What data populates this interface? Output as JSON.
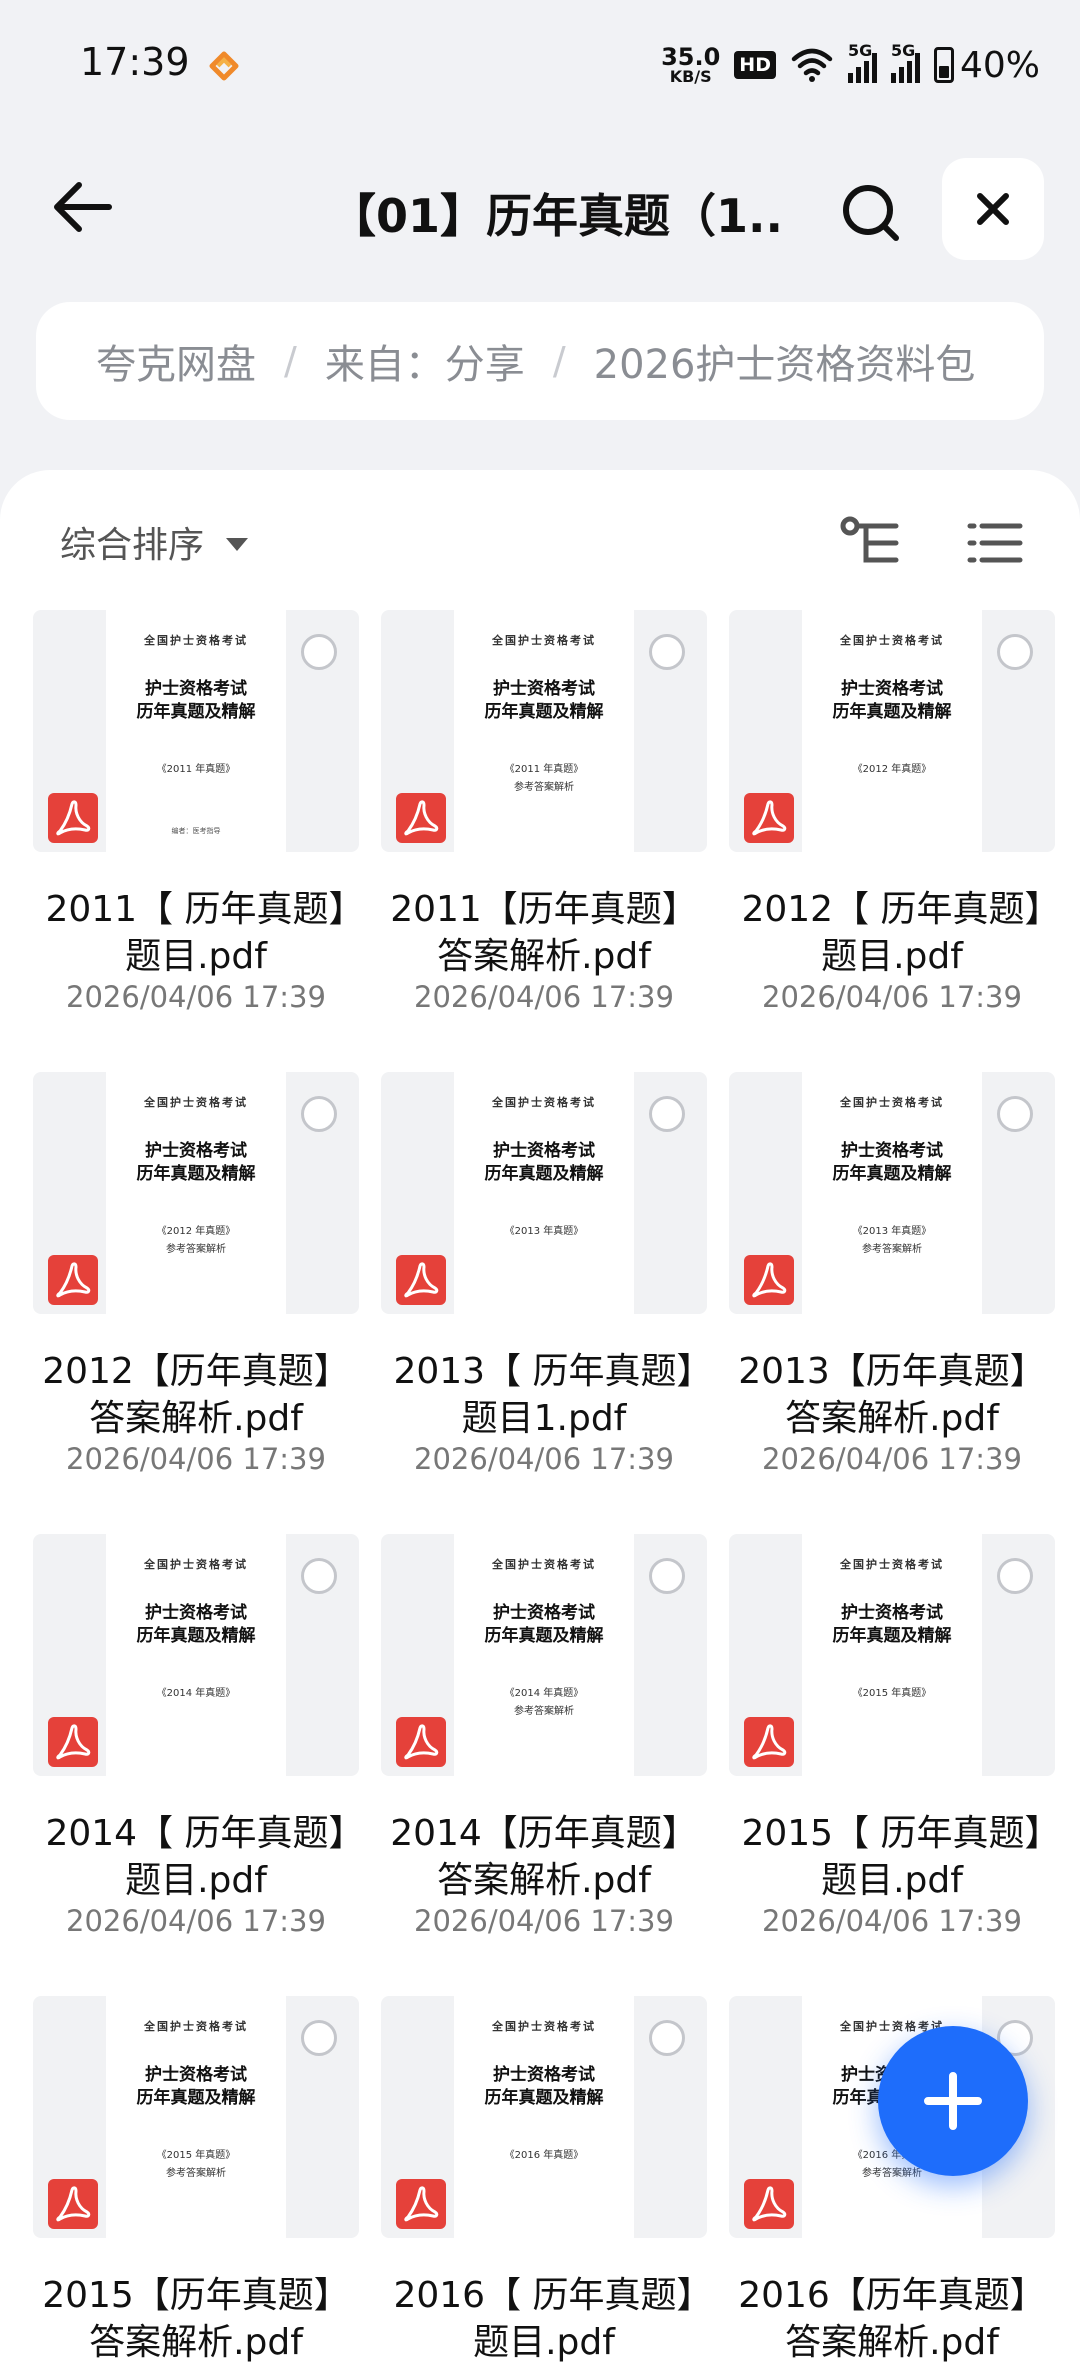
{
  "status_bar": {
    "time": "17:39",
    "net_speed_value": "35.0",
    "net_speed_unit": "KB/S",
    "hd": "HD",
    "sim1": "5G",
    "sim2": "5G",
    "battery": "40%",
    "battery_level": 0.4
  },
  "header": {
    "title": "【01】历年真题（1...",
    "back_icon": "arrow-left-icon",
    "search_icon": "search-icon",
    "close_icon": "close-icon"
  },
  "breadcrumb": [
    "夸克网盘",
    "来自：分享",
    "2026护士资格资料包"
  ],
  "breadcrumb_sep": "/",
  "toolbar": {
    "sort_label": "综合排序",
    "tree_icon": "folder-tree-icon",
    "list_icon": "list-view-icon"
  },
  "doc_common": {
    "header": "全国护士资格考试",
    "title1": "护士资格考试",
    "title2": "历年真题及精解",
    "author": "编者：医考指导"
  },
  "files": [
    {
      "name": "2011【 历年真题】题目.pdf",
      "date": "2026/04/06 17:39",
      "doc_year": "《2011 年真题》",
      "doc_sub": "",
      "show_author": true
    },
    {
      "name": "2011【历年真题】答案解析.pdf",
      "date": "2026/04/06 17:39",
      "doc_year": "《2011 年真题》",
      "doc_sub": "参考答案解析",
      "show_author": false
    },
    {
      "name": "2012【 历年真题】题目.pdf",
      "date": "2026/04/06 17:39",
      "doc_year": "《2012 年真题》",
      "doc_sub": "",
      "show_author": false
    },
    {
      "name": "2012【历年真题】答案解析.pdf",
      "date": "2026/04/06 17:39",
      "doc_year": "《2012 年真题》",
      "doc_sub": "参考答案解析",
      "show_author": false
    },
    {
      "name": "2013【 历年真题】题目1.pdf",
      "date": "2026/04/06 17:39",
      "doc_year": "《2013 年真题》",
      "doc_sub": "",
      "show_author": false
    },
    {
      "name": "2013【历年真题】答案解析.pdf",
      "date": "2026/04/06 17:39",
      "doc_year": "《2013 年真题》",
      "doc_sub": "参考答案解析",
      "show_author": false
    },
    {
      "name": "2014【 历年真题】题目.pdf",
      "date": "2026/04/06 17:39",
      "doc_year": "《2014 年真题》",
      "doc_sub": "",
      "show_author": false
    },
    {
      "name": "2014【历年真题】答案解析.pdf",
      "date": "2026/04/06 17:39",
      "doc_year": "《2014 年真题》",
      "doc_sub": "参考答案解析",
      "show_author": false
    },
    {
      "name": "2015【 历年真题】题目.pdf",
      "date": "2026/04/06 17:39",
      "doc_year": "《2015 年真题》",
      "doc_sub": "",
      "show_author": false
    },
    {
      "name": "2015【历年真题】答案解析.pdf",
      "date": "",
      "doc_year": "《2015 年真题》",
      "doc_sub": "参考答案解析",
      "show_author": false
    },
    {
      "name": "2016【 历年真题】题目.pdf",
      "date": "",
      "doc_year": "《2016 年真题》",
      "doc_sub": "",
      "show_author": false
    },
    {
      "name": "2016【历年真题】答案解析.pdf",
      "date": "",
      "doc_year": "《2016 年真题》",
      "doc_sub": "参考答案解析",
      "show_author": false
    }
  ],
  "fab_icon": "plus-icon",
  "colors": {
    "accent": "#1e6dfb",
    "pdf_red": "#e5413a"
  }
}
